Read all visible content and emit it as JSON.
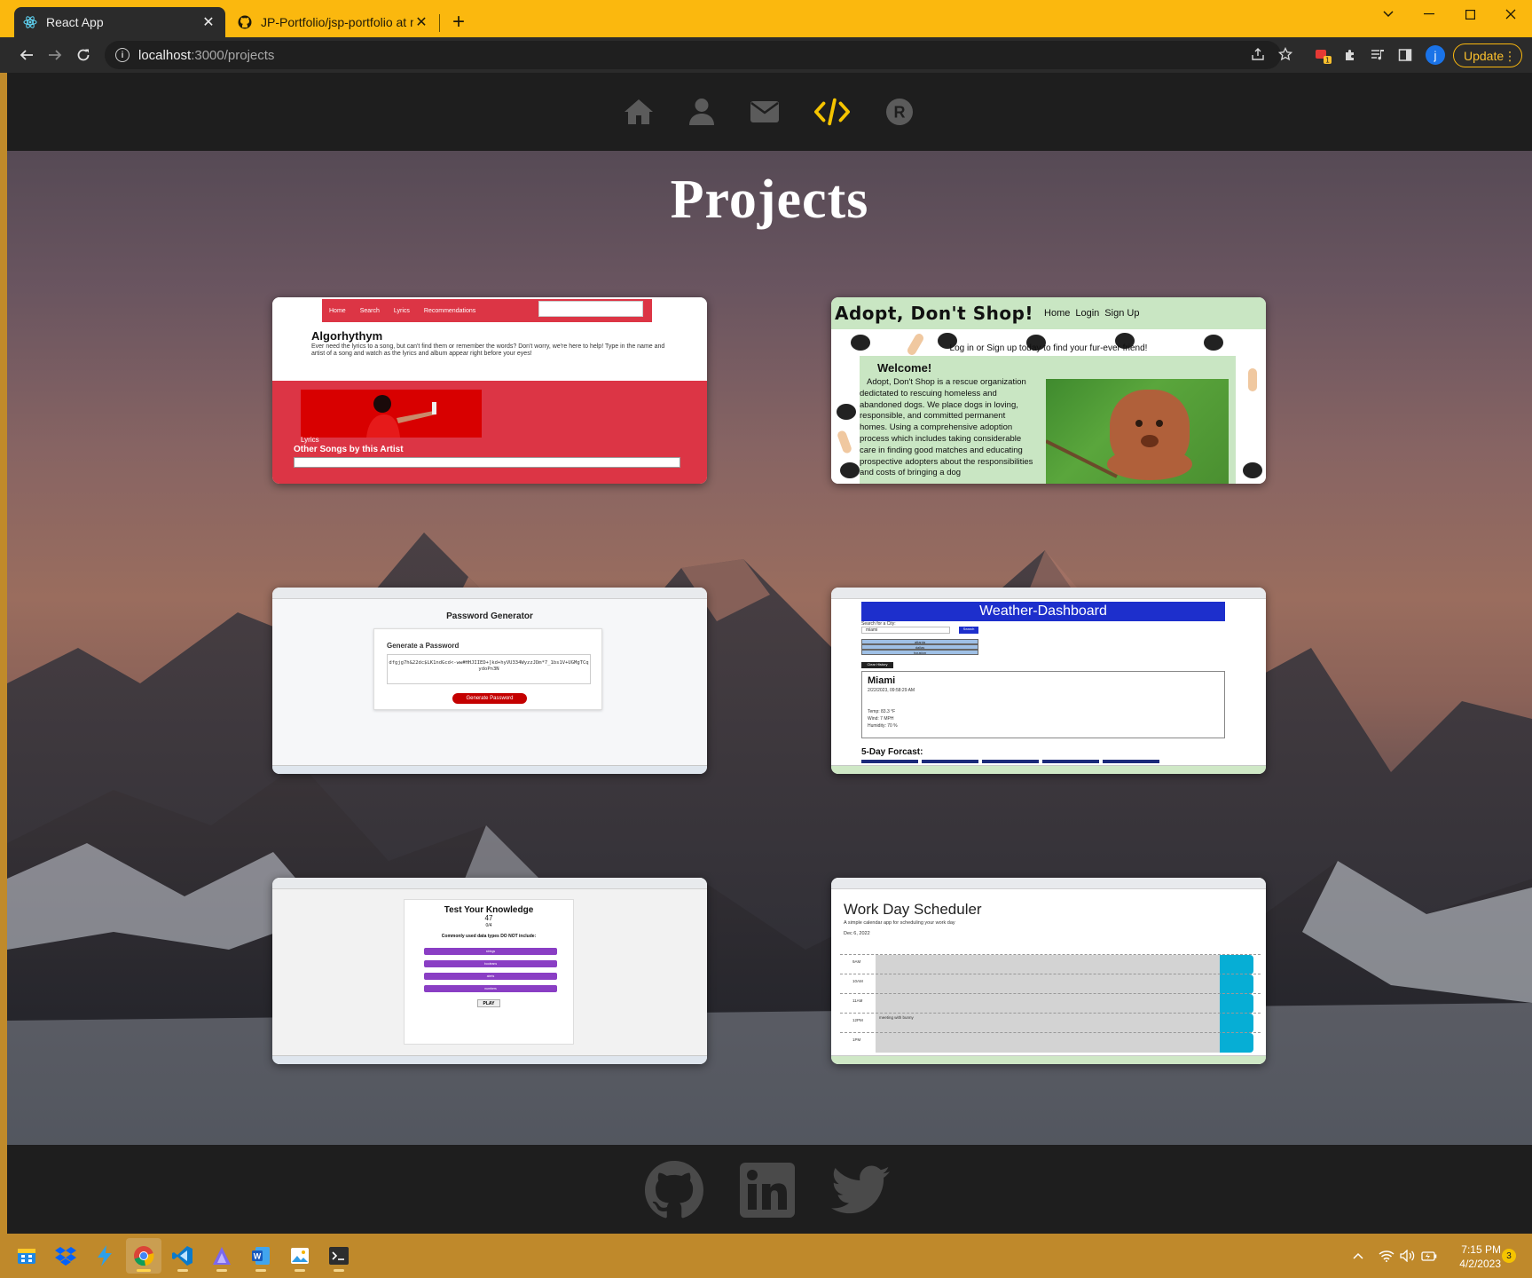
{
  "browser": {
    "tabs": [
      {
        "title": "React App",
        "active": true,
        "icon": "react-icon"
      },
      {
        "title": "JP-Portfolio/jsp-portfolio at main",
        "active": false,
        "icon": "github-icon"
      }
    ],
    "url_host": "localhost",
    "url_path": ":3000/projects",
    "update_label": "Update",
    "profile_initial": "j",
    "extension_badge": "1",
    "accent_color": "#fbb80e"
  },
  "site": {
    "nav": [
      {
        "name": "home",
        "icon": "home-icon"
      },
      {
        "name": "about",
        "icon": "person-icon"
      },
      {
        "name": "contact",
        "icon": "envelope-icon"
      },
      {
        "name": "projects",
        "icon": "code-icon",
        "active": true
      },
      {
        "name": "resume",
        "icon": "resume-r-icon"
      }
    ],
    "active_color": "#f5c400",
    "page_title": "Projects",
    "footer_links": [
      "github-icon",
      "linkedin-icon",
      "twitter-icon"
    ]
  },
  "projects": {
    "algorhythym": {
      "nav_items": [
        "Home",
        "Search",
        "Lyrics",
        "Recommendations"
      ],
      "heading": "Algorhythym",
      "description": "Ever need the lyrics to a song, but can't find them or remember the words? Don't worry, we're here to help! Type in the name and artist of a song and watch as the lyrics and album appear right before your eyes!",
      "lyrics_label": "Lyrics",
      "other_songs": "Other Songs by this Artist"
    },
    "adopt": {
      "logo": "Adopt, Don't Shop!",
      "links": [
        "Home",
        "Login",
        "Sign Up"
      ],
      "tagline": "Log in or Sign up today to find your fur-ever friend!",
      "welcome": "Welcome!",
      "body": "Adopt, Don't Shop is a rescue organization dedictated to rescuing homeless and abandoned dogs. We place dogs in loving, responsible, and committed permanent homes. Using a comprehensive adoption process which includes taking considerable care in finding good matches and educating prospective adopters about the responsibilities and costs of bringing a dog"
    },
    "password": {
      "title": "Password Generator",
      "subtitle": "Generate a Password",
      "sample": "dfgjg7h&22dc$LK1ndGcd<-ww#HHJIIED+]kd+hyVU334WyzzJDm*7_1bs1V+UGMgTCqydoPn3N",
      "button": "Generate Password"
    },
    "weather": {
      "title": "Weather-Dashboard",
      "search_label": "Search for a City:",
      "search_placeholder": "miami",
      "search_button": "Search",
      "history": [
        "atlanta",
        "dallas",
        "houston"
      ],
      "clear_button": "Clear History",
      "city": "Miami",
      "date": "2/22/2023, 09:58:29 AM",
      "temp": "Temp: 83.3 °F",
      "wind": "Wind: 7 MPH",
      "humidity": "Humidity: 70 %",
      "forecast": "5-Day Forcast:"
    },
    "quiz": {
      "title": "Test Your Knowledge",
      "timer": "47",
      "score": "0/4",
      "question": "Commonly used data types DO NOT include:",
      "options": [
        "strings",
        "booleans",
        "alerts",
        "numbers"
      ],
      "play_button": "PLAY"
    },
    "scheduler": {
      "title": "Work Day Scheduler",
      "subtitle": "A simple calendar app for scheduling your work day",
      "date": "Dec 6, 2022",
      "hours": [
        {
          "hour": "9AM",
          "text": ""
        },
        {
          "hour": "10AM",
          "text": ""
        },
        {
          "hour": "11AM",
          "text": ""
        },
        {
          "hour": "12PM",
          "text": "meeting with bunny"
        },
        {
          "hour": "1PM",
          "text": ""
        }
      ]
    }
  },
  "taskbar": {
    "apps": [
      "start-icon",
      "dropbox-icon",
      "azure-icon",
      "chrome-icon",
      "vscode-icon",
      "alteryx-icon",
      "word-icon",
      "paint-icon",
      "terminal-icon"
    ],
    "active_app": "chrome-icon",
    "time": "7:15 PM",
    "date": "4/2/2023",
    "notifications": "3"
  }
}
